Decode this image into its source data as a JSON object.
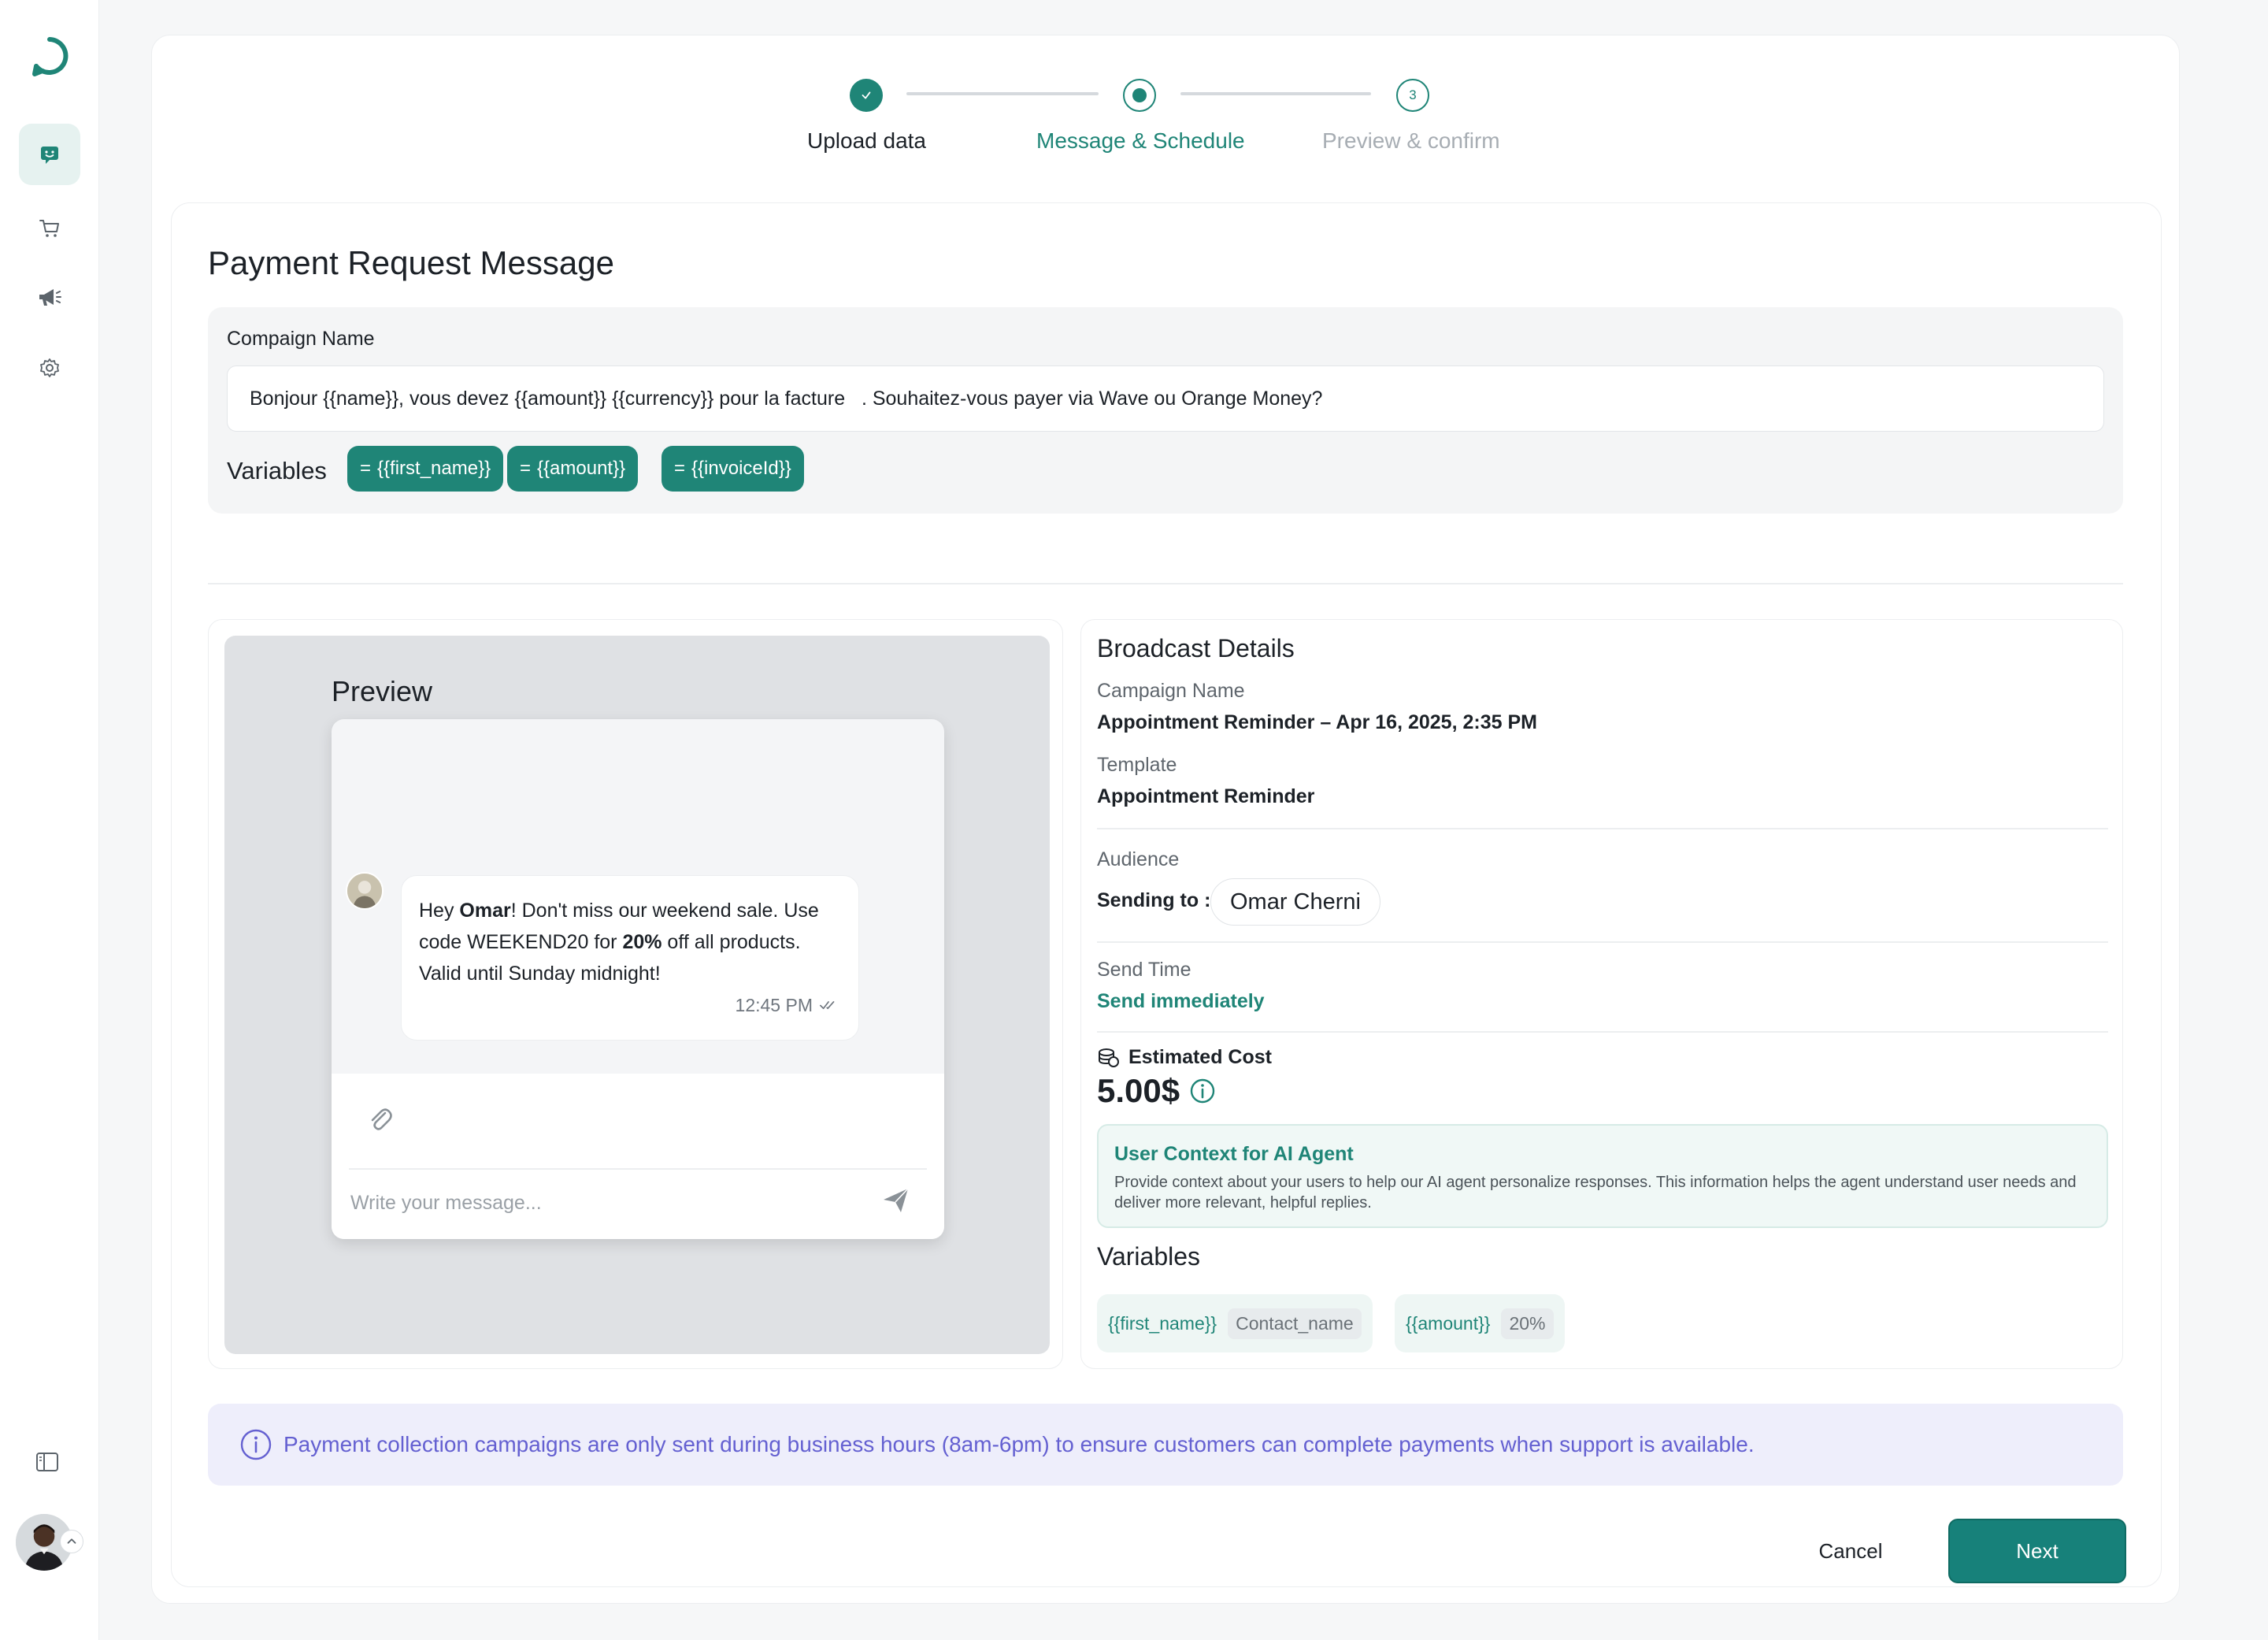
{
  "sidebar": {
    "items": [
      {
        "icon": "chat-icon",
        "active": true
      },
      {
        "icon": "cart-icon",
        "active": false
      },
      {
        "icon": "megaphone-icon",
        "active": false
      },
      {
        "icon": "gear-icon",
        "active": false
      }
    ]
  },
  "stepper": {
    "steps": [
      {
        "label": "Upload data",
        "state": "complete"
      },
      {
        "label": "Message & Schedule",
        "state": "active"
      },
      {
        "label": "Preview & confirm",
        "state": "pending",
        "number": "3"
      }
    ]
  },
  "page": {
    "title": "Payment Request Message"
  },
  "compose": {
    "label": "Compaign Name",
    "message": "Bonjour {{name}}, vous devez {{amount}} {{currency}} pour la facture   . Souhaitez-vous payer via Wave ou Orange Money?",
    "variables_label": "Variables",
    "variables": [
      "{{first_name}}",
      "{{amount}}",
      "{{invoiceId}}"
    ]
  },
  "preview": {
    "title": "Preview",
    "bubble": {
      "part1": "Hey ",
      "name": "Omar",
      "part2": "! Don't miss our weekend sale. Use code WEEKEND20 for ",
      "discount": "20%",
      "part3": " off all products. Valid until Sunday midnight!",
      "time": "12:45 PM"
    },
    "input_placeholder": "Write your message..."
  },
  "details": {
    "title": "Broadcast Details",
    "campaign_label": "Campaign Name",
    "campaign_value": "Appointment Reminder – Apr 16, 2025, 2:35 PM",
    "template_label": "Template",
    "template_value": "Appointment Reminder",
    "audience_label": "Audience",
    "sending_to_label": "Sending to :",
    "sending_to_value": "Omar Cherni",
    "send_time_label": "Send Time",
    "send_time_value": "Send immediately",
    "estimated_cost_label": "Estimated Cost",
    "estimated_cost_value": "5.00$",
    "ai_title": "User Context for AI Agent",
    "ai_desc": "Provide context about your users to help our AI agent personalize responses. This information helps the agent understand user needs and deliver more relevant, helpful replies.",
    "variables_title": "Variables",
    "variables": [
      {
        "name": "{{first_name}}",
        "value": "Contact_name"
      },
      {
        "name": "{{amount}}",
        "value": "20%"
      }
    ]
  },
  "notice": {
    "text": "Payment collection campaigns are only sent during business hours (8am-6pm) to ensure customers can complete payments when support is available."
  },
  "actions": {
    "cancel": "Cancel",
    "next": "Next"
  },
  "colors": {
    "accent": "#1f8577",
    "notice": "#6460d1"
  }
}
